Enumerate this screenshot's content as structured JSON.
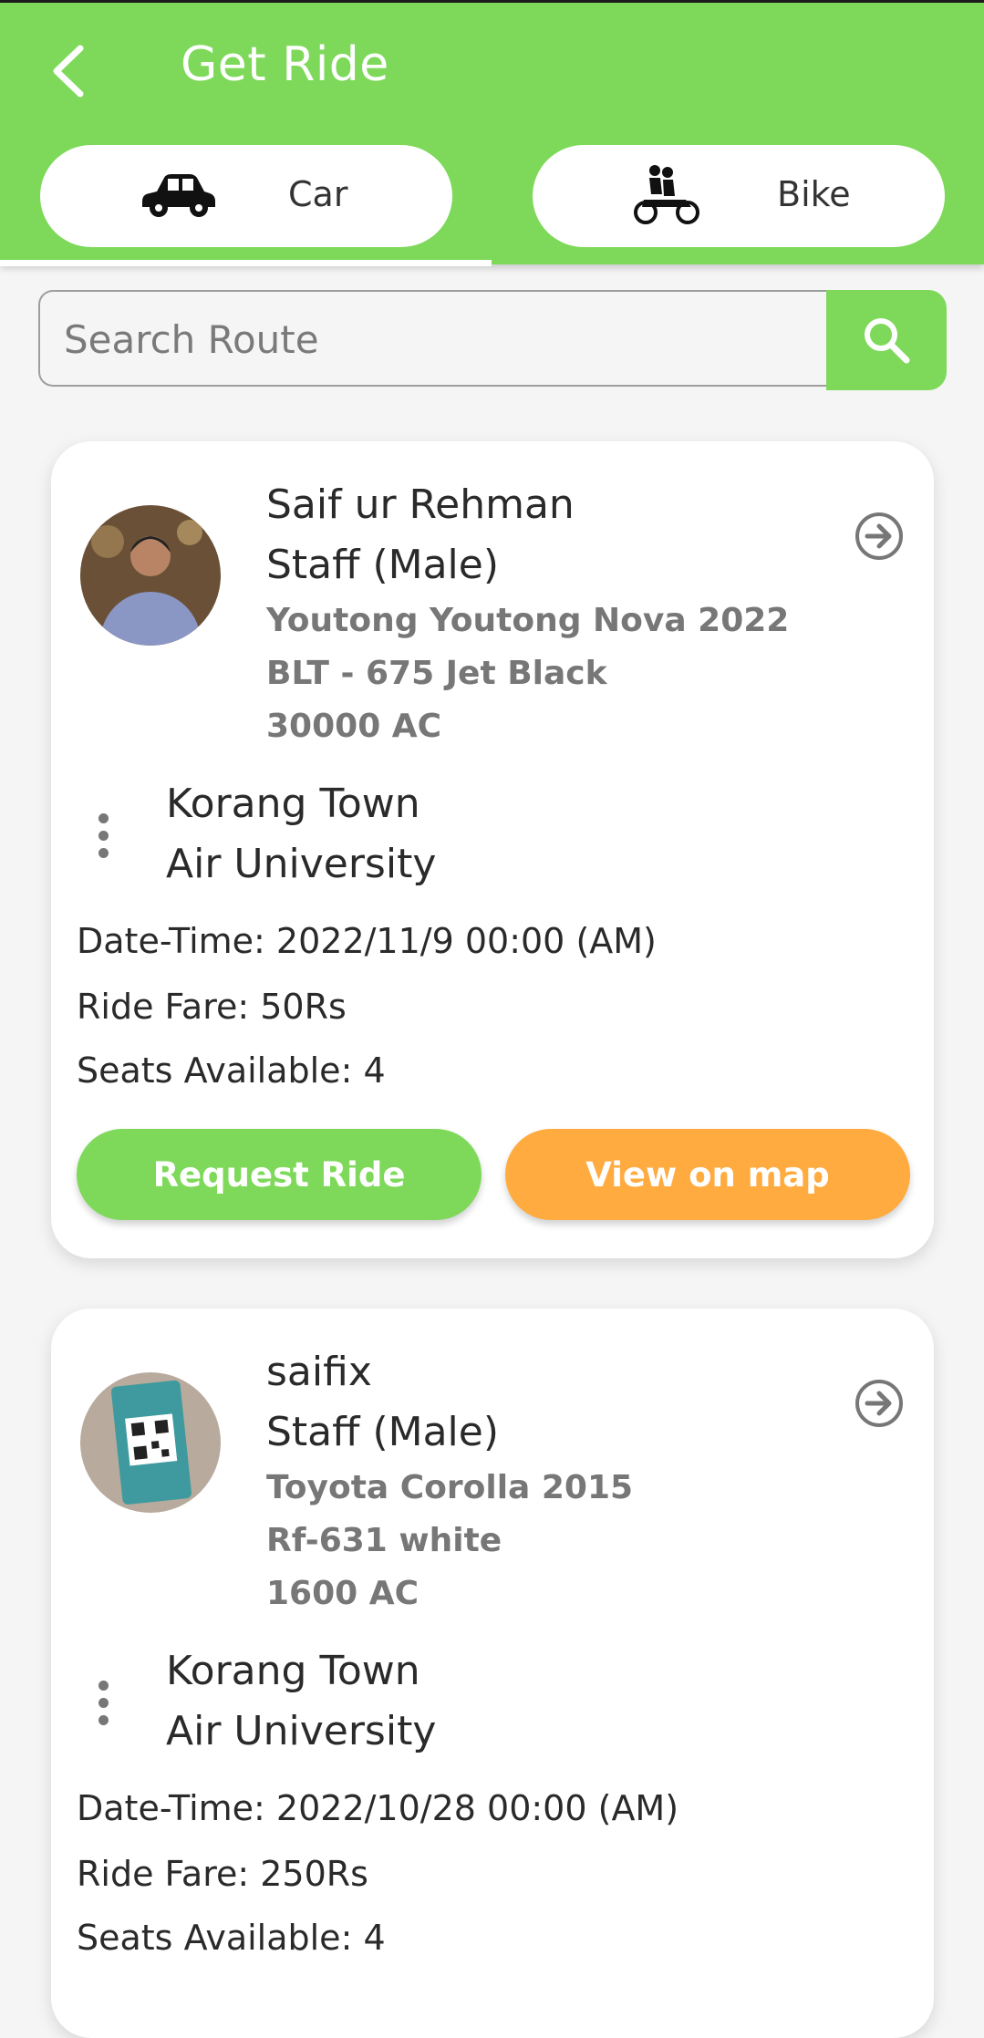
{
  "appbar": {
    "title": "Get Ride",
    "back_icon": "chevron-left-icon"
  },
  "tabs": [
    {
      "label": "Car",
      "icon": "car-icon",
      "selected": true
    },
    {
      "label": "Bike",
      "icon": "motorbike-icon",
      "selected": false
    }
  ],
  "search": {
    "placeholder": "Search Route",
    "value": "",
    "icon": "search-icon"
  },
  "colors": {
    "primary": "#7ed95a",
    "accent": "#ffab40",
    "vehicle_text": "#777777"
  },
  "rides": [
    {
      "name": "Saif ur Rehman",
      "role": "Staff (Male)",
      "vehicle_model": "Youtong Youtong Nova 2022",
      "vehicle_plate": "BLT - 675 Jet Black",
      "vehicle_spec": "30000 AC",
      "from": "Korang Town",
      "to": "Air University",
      "datetime": "Date-Time: 2022/11/9 00:00 (AM)",
      "fare": "Ride Fare: 50Rs",
      "seats": "Seats Available: 4",
      "request_label": "Request Ride",
      "map_label": "View on map"
    },
    {
      "name": "saifix",
      "role": "Staff (Male)",
      "vehicle_model": "Toyota Corolla 2015",
      "vehicle_plate": "Rf-631 white",
      "vehicle_spec": "1600 AC",
      "from": "Korang Town",
      "to": "Air University",
      "datetime": "Date-Time: 2022/10/28 00:00 (AM)",
      "fare": "Ride Fare: 250Rs",
      "seats": "Seats Available: 4"
    }
  ]
}
